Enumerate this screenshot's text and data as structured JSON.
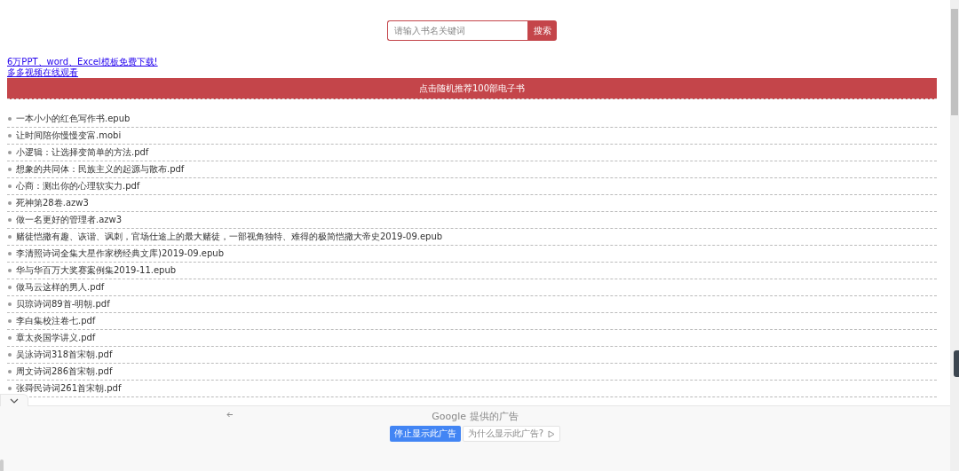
{
  "search": {
    "placeholder": "请输入书名关键词",
    "button": "搜索"
  },
  "links": [
    "6万PPT、word、Excel模板免费下载!",
    "多多视频在线观看"
  ],
  "banner": "点击随机推荐100部电子书",
  "books": [
    "一本小小的红色写作书.epub",
    "让时间陪你慢慢变富.mobi",
    "小逻辑：让选择变简单的方法.pdf",
    "想象的共同体：民族主义的起源与散布.pdf",
    "心商：测出你的心理软实力.pdf",
    "死神第28卷.azw3",
    "做一名更好的管理者.azw3",
    "赌徒恺撒有趣、诙谐、讽刺，官场仕途上的最大赌徒，一部视角独特、难得的极简恺撒大帝史2019-09.epub",
    "李清照诗词全集大星作家榜经典文库)2019-09.epub",
    "华与华百万大奖赛案例集2019-11.epub",
    "做马云这样的男人.pdf",
    "贝琼诗词89首-明朝.pdf",
    "李白集校注卷七.pdf",
    "章太炎国学讲义.pdf",
    "吴泳诗词318首宋朝.pdf",
    "周文诗词286首宋朝.pdf",
    "张舜民诗词261首宋朝.pdf"
  ],
  "ad": {
    "label": "Google 提供的广告",
    "stop_button": "停止显示此广告",
    "why_button": "为什么显示此广告?"
  }
}
